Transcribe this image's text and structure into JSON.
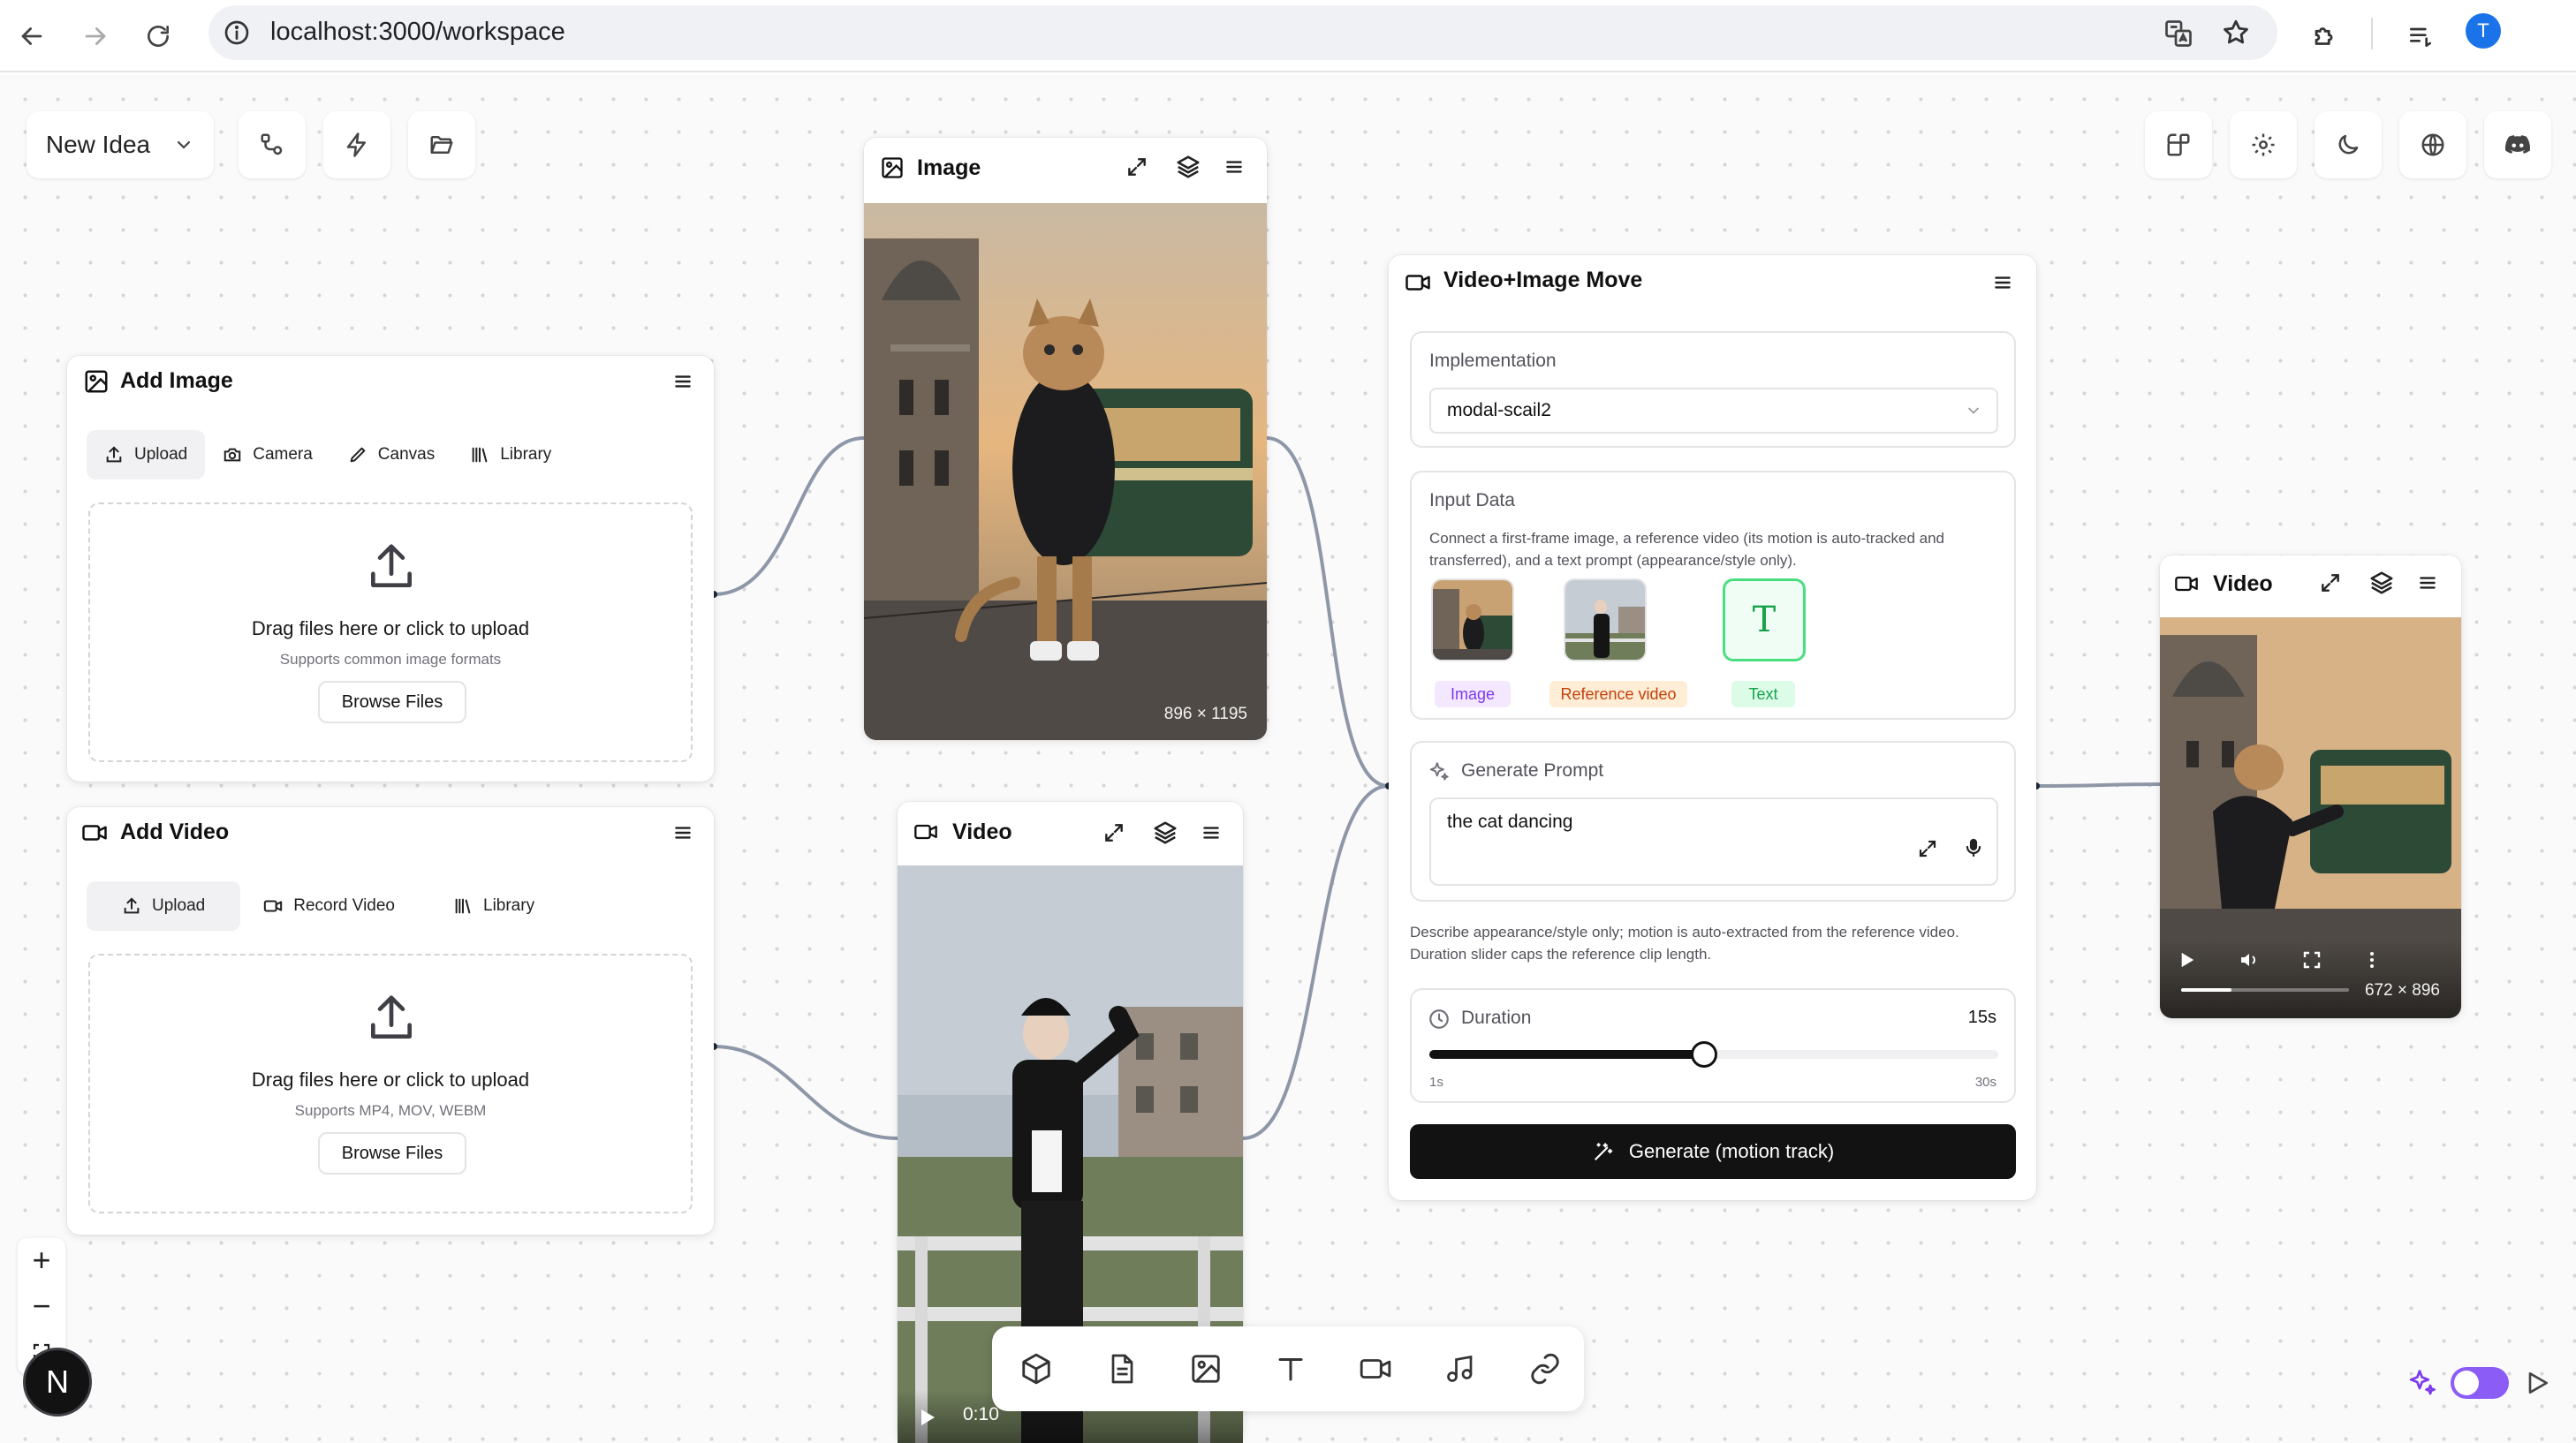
{
  "browser": {
    "url": "localhost:3000/workspace",
    "avatar_letter": "T"
  },
  "toolbar": {
    "project_name": "New Idea",
    "icons": [
      "workflow-icon",
      "bolt-icon",
      "folder-open-icon"
    ],
    "right_icons": [
      "layout-icon",
      "gear-icon",
      "moon-icon",
      "globe-icon",
      "discord-icon"
    ]
  },
  "add_image": {
    "title": "Add Image",
    "tabs": [
      "Upload",
      "Camera",
      "Canvas",
      "Library"
    ],
    "drop_title": "Drag files here or click to upload",
    "drop_sub": "Supports common image formats",
    "browse_label": "Browse Files"
  },
  "add_video": {
    "title": "Add Video",
    "tabs": [
      "Upload",
      "Record Video",
      "Library"
    ],
    "drop_title": "Drag files here or click to upload",
    "drop_sub": "Supports MP4, MOV, WEBM",
    "browse_label": "Browse Files"
  },
  "image_node": {
    "title": "Image",
    "dimensions": "896 × 1195"
  },
  "video_node_input": {
    "title": "Video",
    "time": "0:10"
  },
  "move_node": {
    "title": "Video+Image Move",
    "implementation_label": "Implementation",
    "implementation_value": "modal-scail2",
    "input_data_label": "Input Data",
    "input_data_desc": "Connect a first-frame image, a reference video (its motion is auto-tracked and transferred), and a text prompt (appearance/style only).",
    "inputs": [
      {
        "label": "Image",
        "color": "#7c3aed",
        "bg": "#f3e8ff"
      },
      {
        "label": "Reference video",
        "color": "#c2410c",
        "bg": "#ffedd5"
      },
      {
        "label": "Text",
        "color": "#16a34a",
        "bg": "#dcfce7",
        "glyph": "T"
      }
    ],
    "prompt_label": "Generate Prompt",
    "prompt_value": "the cat dancing",
    "hint": "Describe appearance/style only; motion is auto-extracted from the reference video. Duration slider caps the reference clip length.",
    "duration_label": "Duration",
    "duration_value": "15s",
    "duration_min": "1s",
    "duration_max": "30s",
    "duration_fraction": 0.4828,
    "generate_label": "Generate (motion track)"
  },
  "video_node_output": {
    "title": "Video",
    "dimensions": "672 × 896",
    "progress_fraction": 0.3
  },
  "zoom": {
    "zoom_in": "+",
    "zoom_out": "−",
    "badge_letter": "N"
  },
  "bottom_toolbar": {
    "icons": [
      "cube-icon",
      "document-icon",
      "image-icon",
      "text-icon",
      "video-icon",
      "music-icon",
      "link-icon"
    ]
  },
  "colors": {
    "accent_purple": "#7c3aed",
    "toggle": "#8b5cf6",
    "wire": "#8e97a8"
  }
}
